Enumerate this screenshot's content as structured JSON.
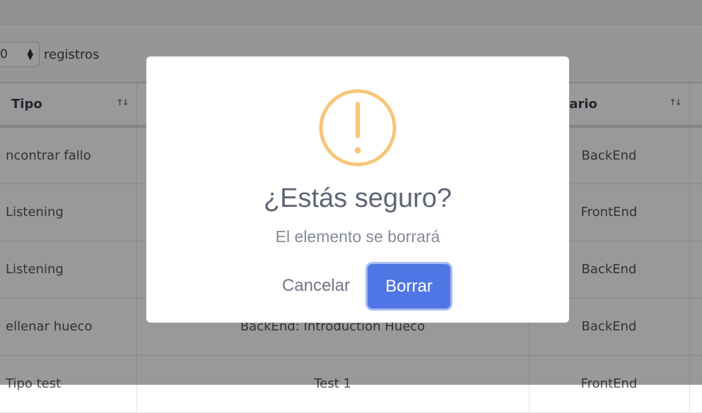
{
  "length_control": {
    "value": "0",
    "label": "registros"
  },
  "table": {
    "headers": {
      "tipo": "Tipo",
      "temario": "Temario"
    },
    "rows": [
      {
        "tipo": "ncontrar fallo",
        "middle": "",
        "temario": "BackEnd"
      },
      {
        "tipo": "Listening",
        "middle": "",
        "temario": "FrontEnd"
      },
      {
        "tipo": "Listening",
        "middle": "",
        "temario": "BackEnd"
      },
      {
        "tipo": "ellenar hueco",
        "middle": "BackEnd: Introduction Hueco",
        "temario": "BackEnd"
      },
      {
        "tipo": "Tipo test",
        "middle": "Test 1",
        "temario": "FrontEnd"
      }
    ]
  },
  "dialog": {
    "icon": "warning-icon",
    "title": "¿Estás seguro?",
    "text": "El elemento se borrará",
    "cancel_label": "Cancelar",
    "confirm_label": "Borrar",
    "colors": {
      "warning": "#f8c57a",
      "confirm": "#4f76e4"
    }
  }
}
